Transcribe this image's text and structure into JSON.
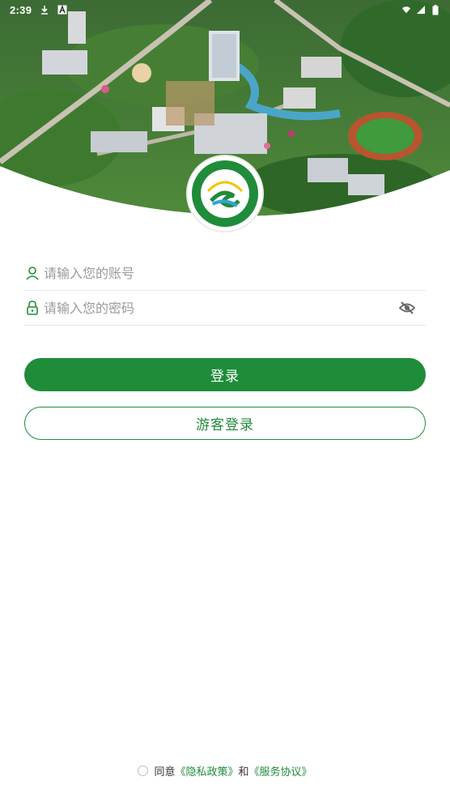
{
  "status_bar": {
    "time": "2:39",
    "left_icons": [
      "download-icon",
      "text-a-icon"
    ],
    "right_icons": [
      "wifi-icon",
      "signal-icon",
      "battery-icon"
    ]
  },
  "hero": {
    "image": "campus-aerial-view",
    "logo": "college-emblem",
    "logo_text": "Guizhou Vocational College of Agriculture"
  },
  "form": {
    "account_placeholder": "请输入您的账号",
    "password_placeholder": "请输入您的密码",
    "account_icon": "user-icon",
    "password_icon": "lock-icon",
    "visibility_icon": "eye-off-icon"
  },
  "buttons": {
    "login": "登录",
    "guest_login": "游客登录"
  },
  "agreement": {
    "prefix": "同意",
    "privacy": "《隐私政策》",
    "conjunction": "和",
    "service": "《服务协议》"
  },
  "colors": {
    "primary": "#1f8c3a",
    "placeholder": "#9a9a9a",
    "divider": "#e6e6e6"
  }
}
